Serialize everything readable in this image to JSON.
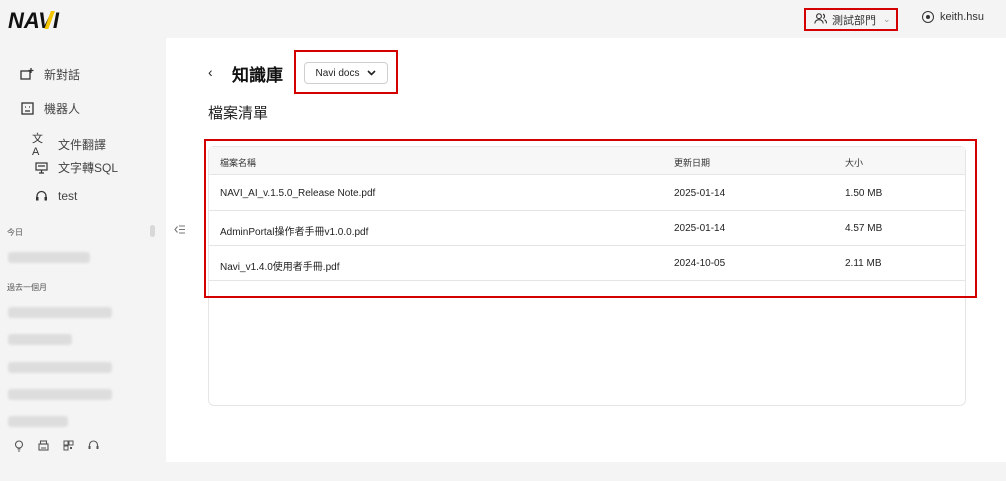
{
  "brand": {
    "logo_text": "NAVI"
  },
  "sidebar": {
    "items": [
      {
        "label": "新對話",
        "icon": "new-chat-icon"
      },
      {
        "label": "機器人",
        "icon": "robot-icon"
      }
    ],
    "sub_items": [
      {
        "label": "文件翻譯",
        "icon": "translate-icon"
      },
      {
        "label": "文字轉SQL",
        "icon": "monitor-icon"
      },
      {
        "label": "test",
        "icon": "headset-icon"
      }
    ],
    "section_today": "今日",
    "section_past": "過去一個月",
    "bottom_icons": [
      "lightbulb-icon",
      "printer-icon",
      "qr-icon",
      "headset-icon"
    ]
  },
  "topbar": {
    "department": "測試部門",
    "username": "keith.hsu"
  },
  "main": {
    "title": "知識庫",
    "selected_kb": "Navi docs",
    "file_list_title": "檔案清單",
    "columns": [
      "檔案名稱",
      "更新日期",
      "大小"
    ],
    "rows": [
      {
        "name": "NAVI_AI_v.1.5.0_Release Note.pdf",
        "date": "2025-01-14",
        "size": "1.50 MB"
      },
      {
        "name": "AdminPortal操作者手冊v1.0.0.pdf",
        "date": "2025-01-14",
        "size": "4.57 MB"
      },
      {
        "name": "Navi_v1.4.0使用者手冊.pdf",
        "date": "2024-10-05",
        "size": "2.11 MB"
      }
    ]
  }
}
